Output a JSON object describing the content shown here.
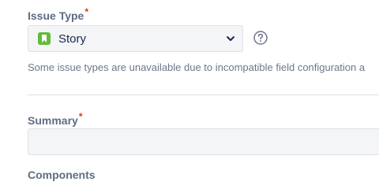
{
  "issue_type": {
    "label": "Issue Type",
    "required_mark": "*",
    "selected_value": "Story",
    "selected_icon": "story-icon",
    "hint": "Some issue types are unavailable due to incompatible field configuration a",
    "help_icon": "question-circle-icon"
  },
  "summary": {
    "label": "Summary",
    "required_mark": "*",
    "value": ""
  },
  "components": {
    "label": "Components"
  },
  "colors": {
    "label": "#5e6c84",
    "required": "#de350b",
    "story": "#63ba3c",
    "input_bg": "#f4f5f7",
    "border": "#dfe1e6"
  }
}
